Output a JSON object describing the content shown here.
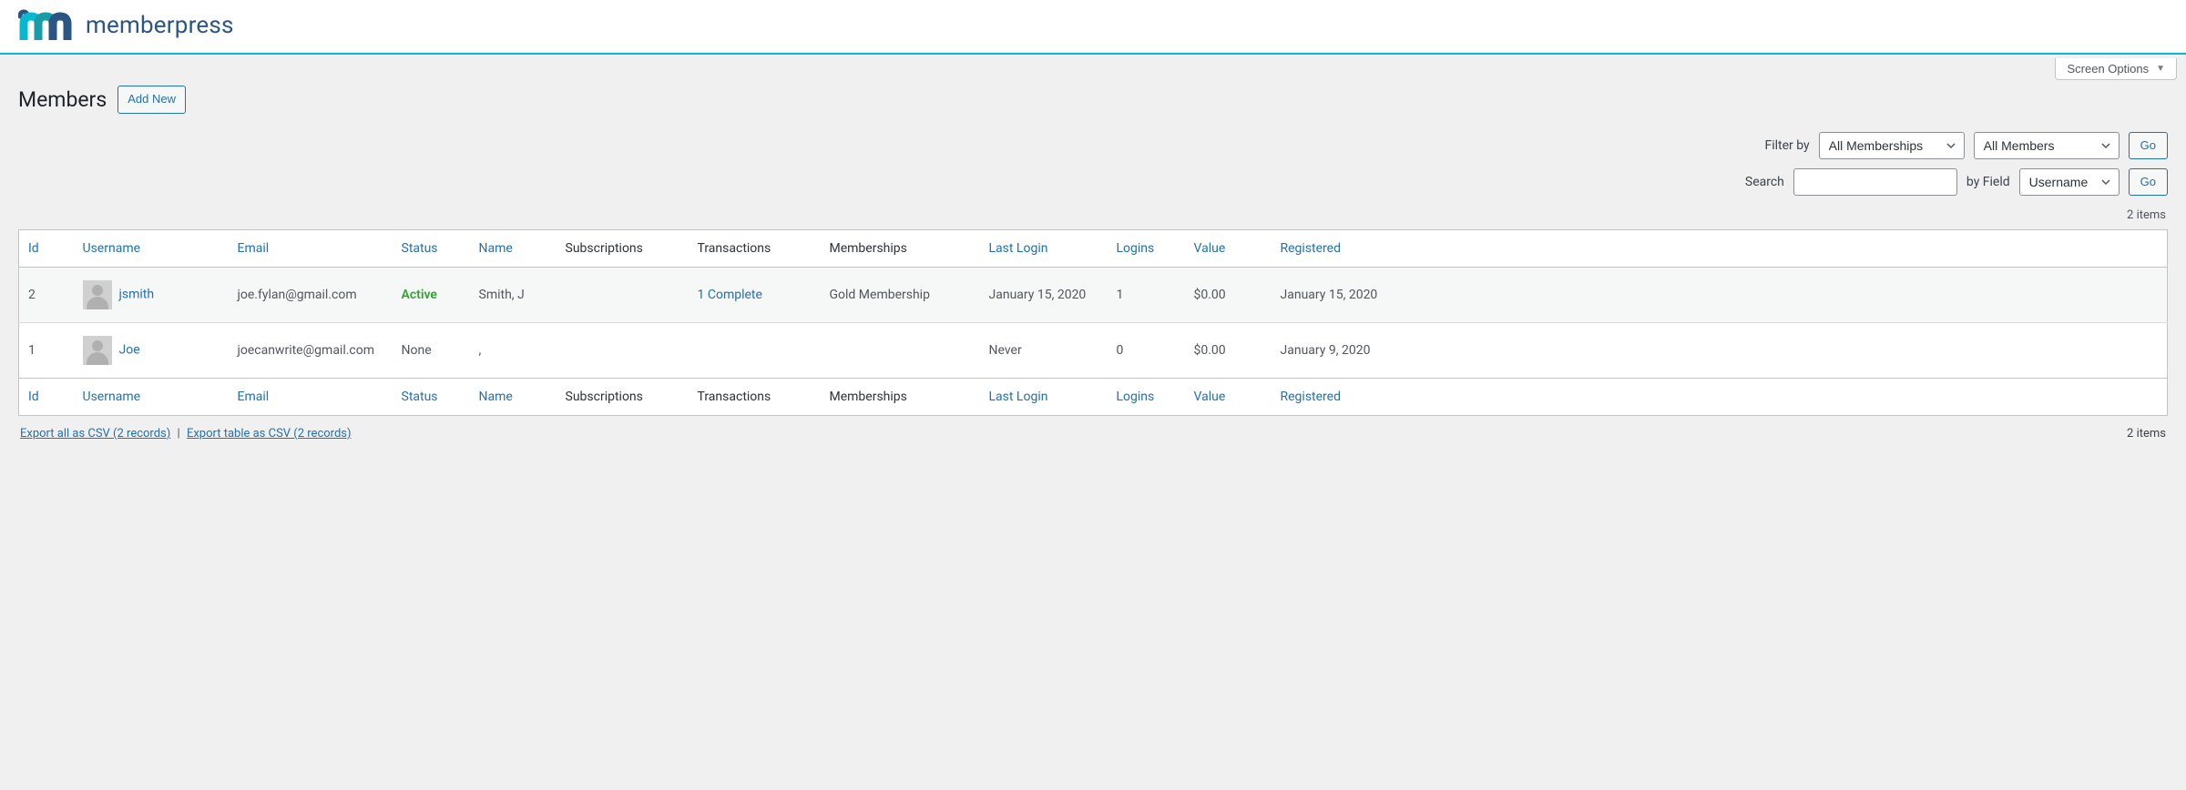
{
  "brand": {
    "name": "memberpress"
  },
  "screen_options": {
    "label": "Screen Options"
  },
  "page": {
    "title": "Members",
    "add_new": "Add New"
  },
  "filters": {
    "filter_by_label": "Filter by",
    "membership_select": "All Memberships",
    "members_select": "All Members",
    "search_label": "Search",
    "by_field_label": "by Field",
    "field_select": "Username",
    "go": "Go"
  },
  "items_count": "2 items",
  "columns": {
    "id": "Id",
    "username": "Username",
    "email": "Email",
    "status": "Status",
    "name": "Name",
    "subscriptions": "Subscriptions",
    "transactions": "Transactions",
    "memberships": "Memberships",
    "last_login": "Last Login",
    "logins": "Logins",
    "value": "Value",
    "registered": "Registered"
  },
  "rows": [
    {
      "id": "2",
      "username": "jsmith",
      "email": "joe.fylan@gmail.com",
      "status": "Active",
      "status_class": "status-active",
      "name": "Smith, J",
      "subscriptions": "",
      "transactions": "1 Complete",
      "transactions_link": true,
      "memberships": "Gold Membership",
      "last_login": "January 15, 2020",
      "logins": "1",
      "value": "$0.00",
      "registered": "January 15, 2020"
    },
    {
      "id": "1",
      "username": "Joe",
      "email": "joecanwrite@gmail.com",
      "status": "None",
      "status_class": "",
      "name": ",",
      "subscriptions": "",
      "transactions": "",
      "transactions_link": false,
      "memberships": "",
      "last_login": "Never",
      "logins": "0",
      "value": "$0.00",
      "registered": "January 9, 2020"
    }
  ],
  "footer": {
    "export_all": "Export all as CSV (2 records)",
    "export_table": "Export table as CSV (2 records)",
    "items_count": "2 items"
  }
}
